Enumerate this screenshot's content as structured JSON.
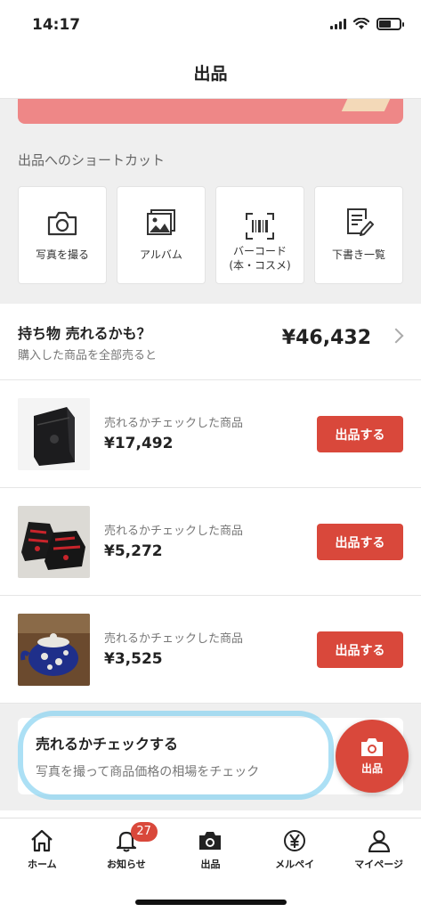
{
  "status_bar": {
    "time": "14:17"
  },
  "nav": {
    "title": "出品"
  },
  "shortcuts": {
    "title": "出品へのショートカット",
    "items": [
      {
        "label": "写真を撮る",
        "icon": "camera-icon"
      },
      {
        "label": "アルバム",
        "icon": "album-icon"
      },
      {
        "label": "バーコード\n(本・コスメ)",
        "icon": "barcode-icon"
      },
      {
        "label": "下書き一覧",
        "icon": "draft-icon"
      }
    ]
  },
  "stats": {
    "title": "持ち物 売れるかも？",
    "subtitle": "購入した商品を全部売ると",
    "value": "¥46,432"
  },
  "items": [
    {
      "label": "売れるかチェックした商品",
      "price": "¥17,492",
      "button": "出品する"
    },
    {
      "label": "売れるかチェックした商品",
      "price": "¥5,272",
      "button": "出品する"
    },
    {
      "label": "売れるかチェックした商品",
      "price": "¥3,525",
      "button": "出品する"
    }
  ],
  "check": {
    "title": "売れるかチェックする",
    "subtitle": "写真を撮って商品価格の相場をチェック"
  },
  "fab": {
    "label": "出品"
  },
  "tabs": [
    {
      "label": "ホーム",
      "icon": "home-icon"
    },
    {
      "label": "お知らせ",
      "icon": "bell-icon",
      "badge": "27"
    },
    {
      "label": "出品",
      "icon": "camera-icon"
    },
    {
      "label": "メルペイ",
      "icon": "yen-icon"
    },
    {
      "label": "マイページ",
      "icon": "person-icon"
    }
  ],
  "colors": {
    "accent": "#d9483b",
    "banner": "#ee8787",
    "highlight": "#7fd0f0"
  }
}
